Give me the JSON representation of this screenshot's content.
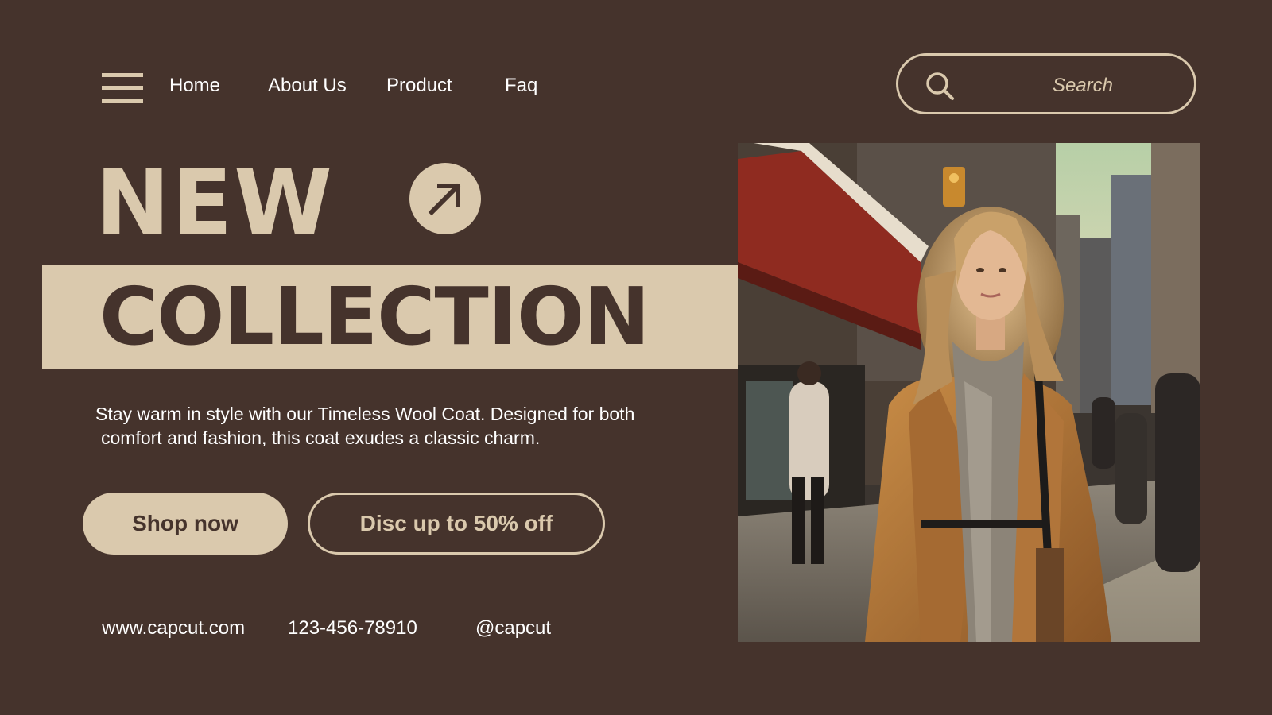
{
  "nav": {
    "items": [
      {
        "label": "Home"
      },
      {
        "label": "About Us"
      },
      {
        "label": "Product"
      },
      {
        "label": "Faq"
      }
    ]
  },
  "search": {
    "placeholder": "Search"
  },
  "hero": {
    "line1": "NEW",
    "line2": "COLLECTION",
    "description_line1": "Stay warm in style with our Timeless Wool Coat. Designed for both",
    "description_line2": "comfort and fashion, this coat exudes a classic charm."
  },
  "buttons": {
    "shop_label": "Shop now",
    "discount_label": "Disc up to 50% off"
  },
  "footer": {
    "website": "www.capcut.com",
    "phone": "123-456-78910",
    "social": "@capcut"
  },
  "icons": {
    "menu": "menu-icon",
    "search": "search-icon",
    "arrow": "arrow-up-right-icon"
  },
  "colors": {
    "background": "#45332c",
    "accent": "#dac9ad",
    "text": "#ffffff"
  }
}
